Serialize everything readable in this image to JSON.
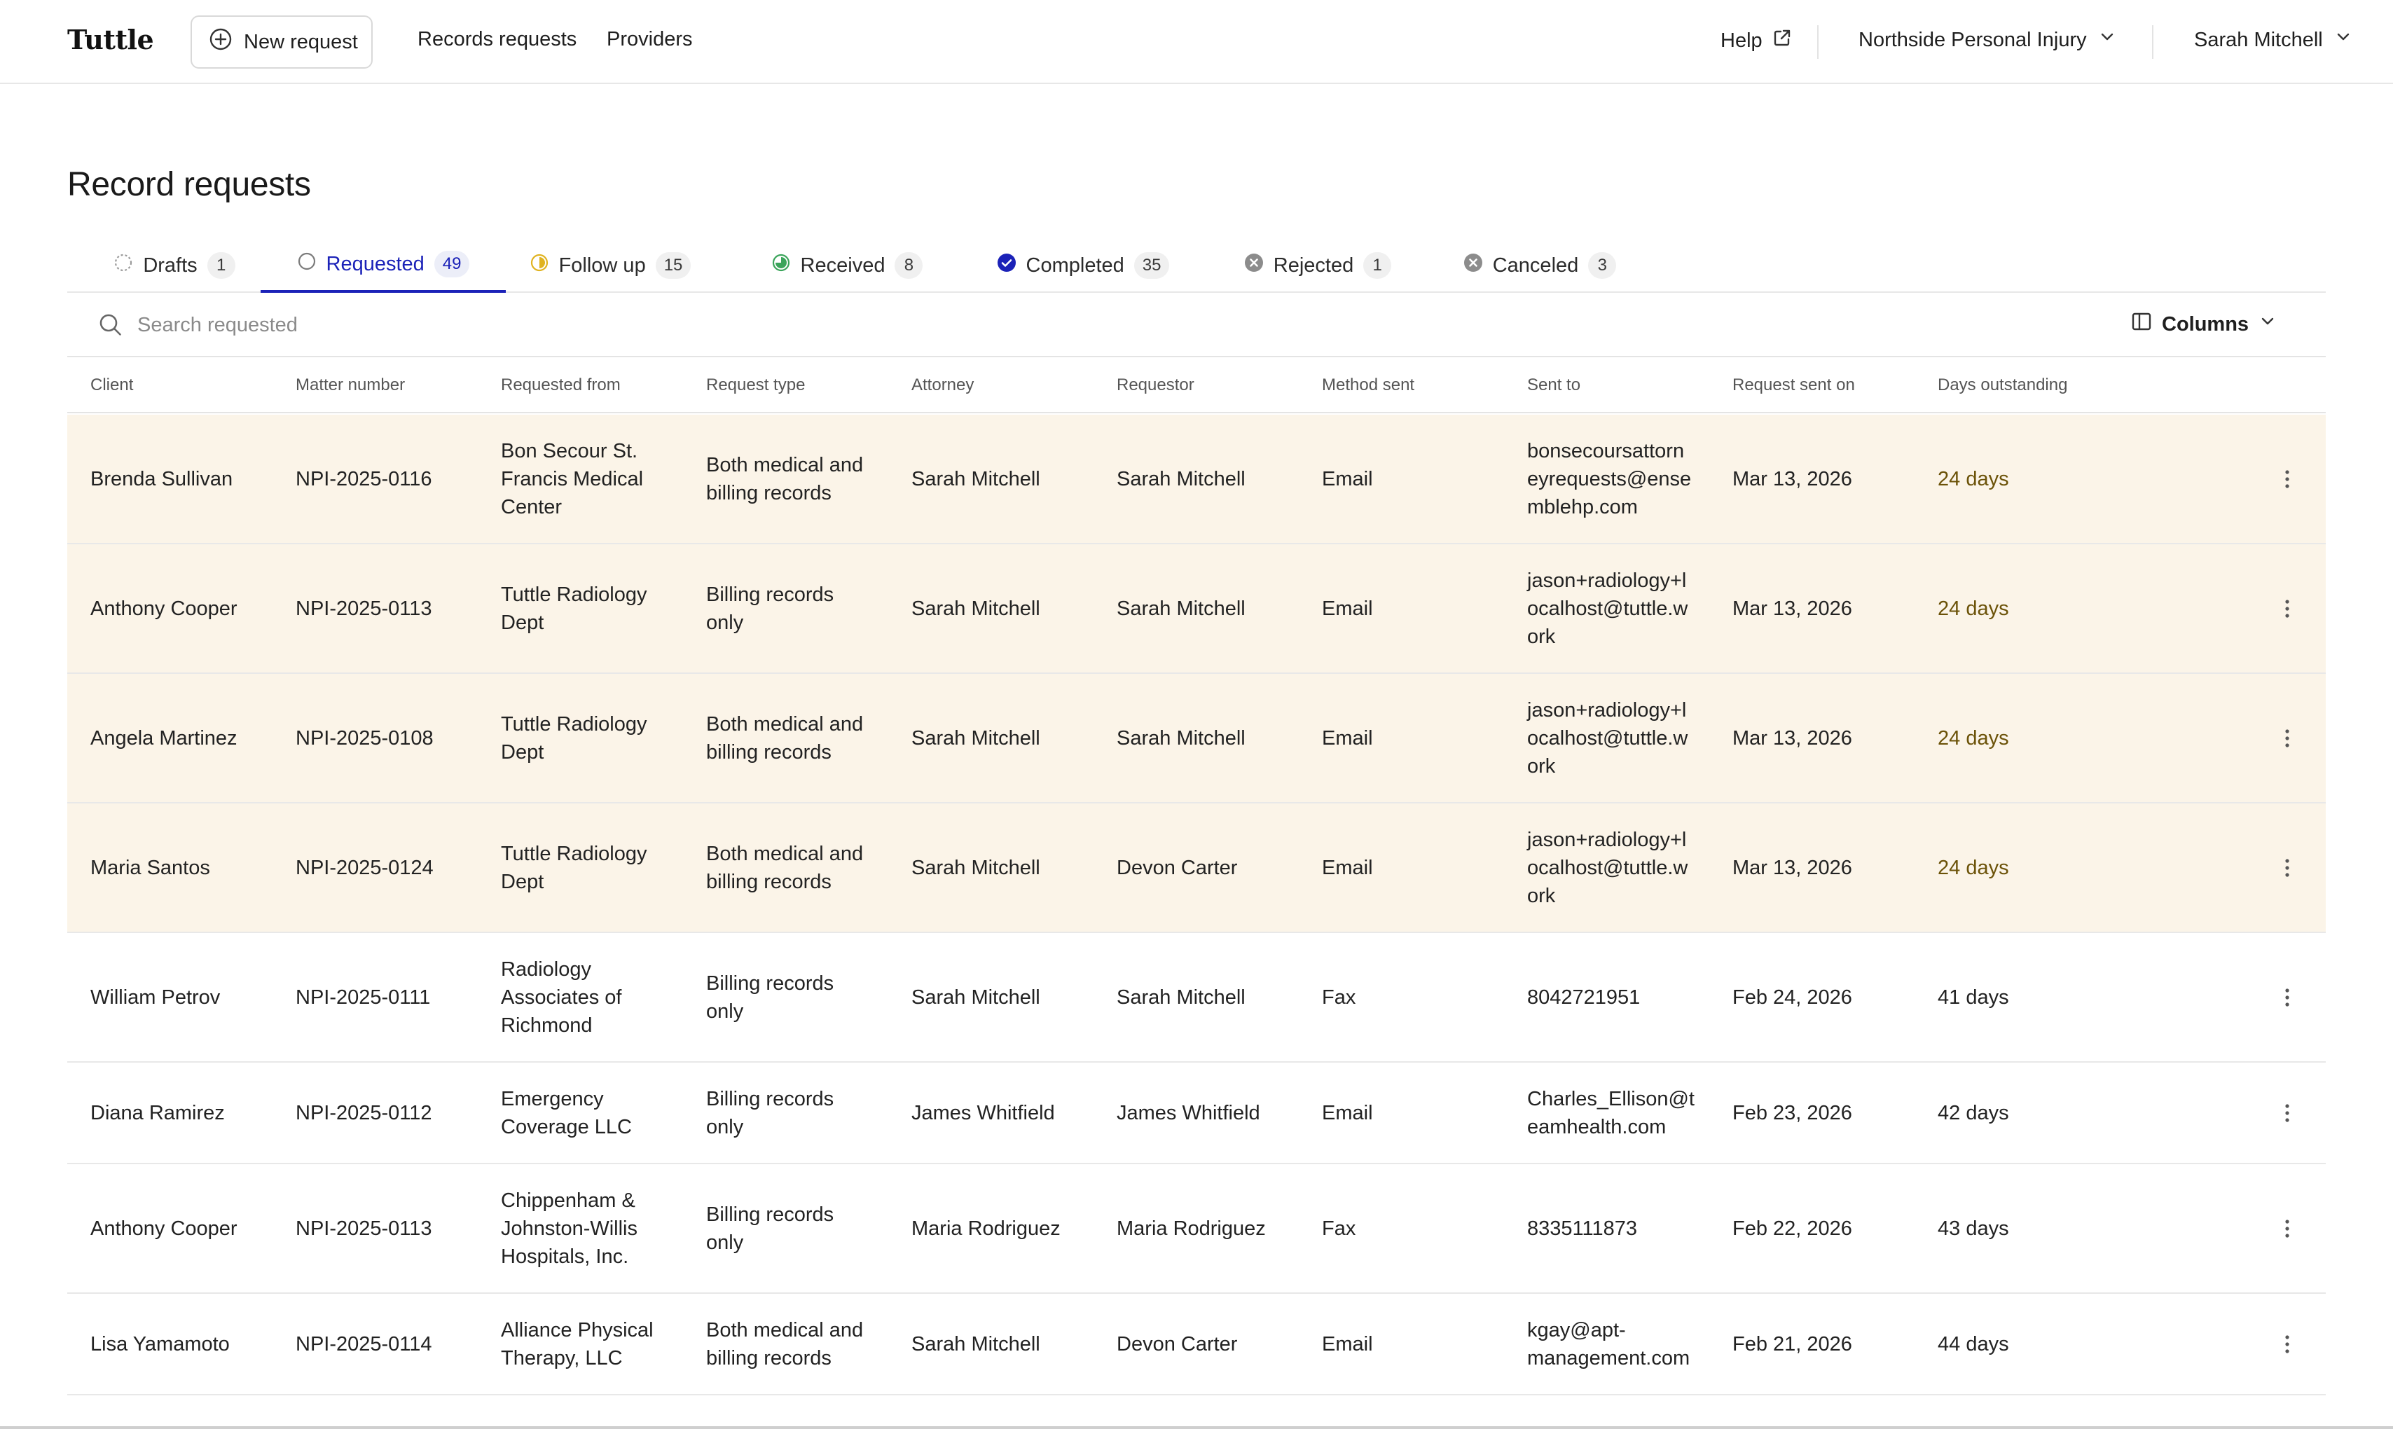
{
  "brand": "Tuttle",
  "nav": {
    "new_request": "New request",
    "records_requests": "Records requests",
    "providers": "Providers",
    "help": "Help",
    "organization": "Northside Personal Injury",
    "user": "Sarah Mitchell"
  },
  "page": {
    "title": "Record requests"
  },
  "tabs": [
    {
      "label": "Drafts",
      "count": "1",
      "icon": "dashed-circle-icon"
    },
    {
      "label": "Requested",
      "count": "49",
      "icon": "empty-circle-icon",
      "active": true
    },
    {
      "label": "Follow up",
      "count": "15",
      "icon": "half-circle-icon"
    },
    {
      "label": "Received",
      "count": "8",
      "icon": "progress-circle-icon"
    },
    {
      "label": "Completed",
      "count": "35",
      "icon": "check-circle-icon"
    },
    {
      "label": "Rejected",
      "count": "1",
      "icon": "x-circle-icon"
    },
    {
      "label": "Canceled",
      "count": "3",
      "icon": "x-circle-icon"
    }
  ],
  "search": {
    "placeholder": "Search requested"
  },
  "columns_button": "Columns",
  "table": {
    "headers": [
      "Client",
      "Matter number",
      "Requested from",
      "Request type",
      "Attorney",
      "Requestor",
      "Method sent",
      "Sent to",
      "Request sent on",
      "Days outstanding"
    ],
    "rows": [
      {
        "client": "Brenda Sullivan",
        "matter": "NPI-2025-0116",
        "from": [
          "Bon Secour St.",
          "Francis Medical",
          "Center"
        ],
        "type": [
          "Both medical and",
          "billing records"
        ],
        "attorney": "Sarah Mitchell",
        "requestor": "Sarah Mitchell",
        "method": "Email",
        "sent_to": [
          "bonsecoursattorn",
          "eyrequests@ense",
          "mblehp.com"
        ],
        "sent_on": "Mar 13, 2026",
        "days": "24 days",
        "overdue": true
      },
      {
        "client": "Anthony Cooper",
        "matter": "NPI-2025-0113",
        "from": [
          "Tuttle Radiology",
          "Dept"
        ],
        "type": [
          "Billing records",
          "only"
        ],
        "attorney": "Sarah Mitchell",
        "requestor": "Sarah Mitchell",
        "method": "Email",
        "sent_to": [
          "jason+radiology+l",
          "ocalhost@tuttle.w",
          "ork"
        ],
        "sent_on": "Mar 13, 2026",
        "days": "24 days",
        "overdue": true
      },
      {
        "client": "Angela Martinez",
        "matter": "NPI-2025-0108",
        "from": [
          "Tuttle Radiology",
          "Dept"
        ],
        "type": [
          "Both medical and",
          "billing records"
        ],
        "attorney": "Sarah Mitchell",
        "requestor": "Sarah Mitchell",
        "method": "Email",
        "sent_to": [
          "jason+radiology+l",
          "ocalhost@tuttle.w",
          "ork"
        ],
        "sent_on": "Mar 13, 2026",
        "days": "24 days",
        "overdue": true
      },
      {
        "client": "Maria Santos",
        "matter": "NPI-2025-0124",
        "from": [
          "Tuttle Radiology",
          "Dept"
        ],
        "type": [
          "Both medical and",
          "billing records"
        ],
        "attorney": "Sarah Mitchell",
        "requestor": "Devon Carter",
        "method": "Email",
        "sent_to": [
          "jason+radiology+l",
          "ocalhost@tuttle.w",
          "ork"
        ],
        "sent_on": "Mar 13, 2026",
        "days": "24 days",
        "overdue": true
      },
      {
        "client": "William Petrov",
        "matter": "NPI-2025-0111",
        "from": [
          "Radiology",
          "Associates of",
          "Richmond"
        ],
        "type": [
          "Billing records",
          "only"
        ],
        "attorney": "Sarah Mitchell",
        "requestor": "Sarah Mitchell",
        "method": "Fax",
        "sent_to": [
          "8042721951"
        ],
        "sent_on": "Feb 24, 2026",
        "days": "41 days",
        "overdue": false
      },
      {
        "client": "Diana Ramirez",
        "matter": "NPI-2025-0112",
        "from": [
          "Emergency",
          "Coverage LLC"
        ],
        "type": [
          "Billing records",
          "only"
        ],
        "attorney": "James Whitfield",
        "requestor": "James Whitfield",
        "method": "Email",
        "sent_to": [
          "Charles_Ellison@t",
          "eamhealth.com"
        ],
        "sent_on": "Feb 23, 2026",
        "days": "42 days",
        "overdue": false
      },
      {
        "client": "Anthony Cooper",
        "matter": "NPI-2025-0113",
        "from": [
          "Chippenham &",
          "Johnston-Willis",
          "Hospitals, Inc."
        ],
        "type": [
          "Billing records",
          "only"
        ],
        "attorney": "Maria Rodriguez",
        "requestor": "Maria Rodriguez",
        "method": "Fax",
        "sent_to": [
          "8335111873"
        ],
        "sent_on": "Feb 22, 2026",
        "days": "43 days",
        "overdue": false
      },
      {
        "client": "Lisa Yamamoto",
        "matter": "NPI-2025-0114",
        "from": [
          "Alliance Physical",
          "Therapy, LLC"
        ],
        "type": [
          "Both medical and",
          "billing records"
        ],
        "attorney": "Sarah Mitchell",
        "requestor": "Devon Carter",
        "method": "Email",
        "sent_to": [
          "kgay@apt-",
          "management.com"
        ],
        "sent_on": "Feb 21, 2026",
        "days": "44 days",
        "overdue": false
      }
    ]
  },
  "colors": {
    "accent": "#1b22b8",
    "overdue_row": "#fbf4e8",
    "follow_up": "#e0b320",
    "received": "#3aa45a",
    "completed": "#1b22b8",
    "rejected": "#8c8c8c"
  }
}
